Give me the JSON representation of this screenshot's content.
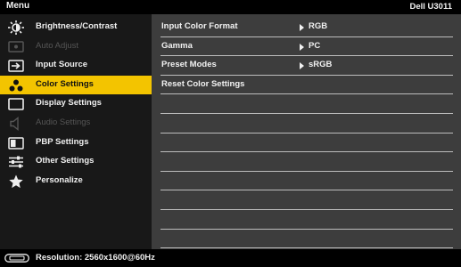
{
  "header": {
    "title": "Menu",
    "model": "Dell U3011"
  },
  "sidebar": {
    "items": [
      {
        "label": "Brightness/Contrast",
        "icon": "brightness-icon",
        "state": "enabled"
      },
      {
        "label": "Auto Adjust",
        "icon": "auto-adjust-icon",
        "state": "disabled"
      },
      {
        "label": "Input Source",
        "icon": "input-source-icon",
        "state": "enabled"
      },
      {
        "label": "Color Settings",
        "icon": "color-settings-icon",
        "state": "selected"
      },
      {
        "label": "Display Settings",
        "icon": "display-settings-icon",
        "state": "enabled"
      },
      {
        "label": "Audio Settings",
        "icon": "speaker-icon",
        "state": "disabled"
      },
      {
        "label": "PBP Settings",
        "icon": "pbp-icon",
        "state": "enabled"
      },
      {
        "label": "Other Settings",
        "icon": "sliders-icon",
        "state": "enabled"
      },
      {
        "label": "Personalize",
        "icon": "star-icon",
        "state": "enabled"
      }
    ]
  },
  "panel": {
    "rows": [
      {
        "label": "Input Color Format",
        "value": "RGB"
      },
      {
        "label": "Gamma",
        "value": "PC"
      },
      {
        "label": "Preset Modes",
        "value": "sRGB"
      },
      {
        "label": "Reset Color Settings",
        "value": ""
      }
    ],
    "empty_row_count": 8
  },
  "footer": {
    "resolution": "Resolution: 2560x1600@60Hz",
    "icon": "connector-icon"
  },
  "colors": {
    "selected": "#f3c400",
    "panel": "#3d3d3d",
    "sidebar": "#181818",
    "bar": "#000000"
  }
}
